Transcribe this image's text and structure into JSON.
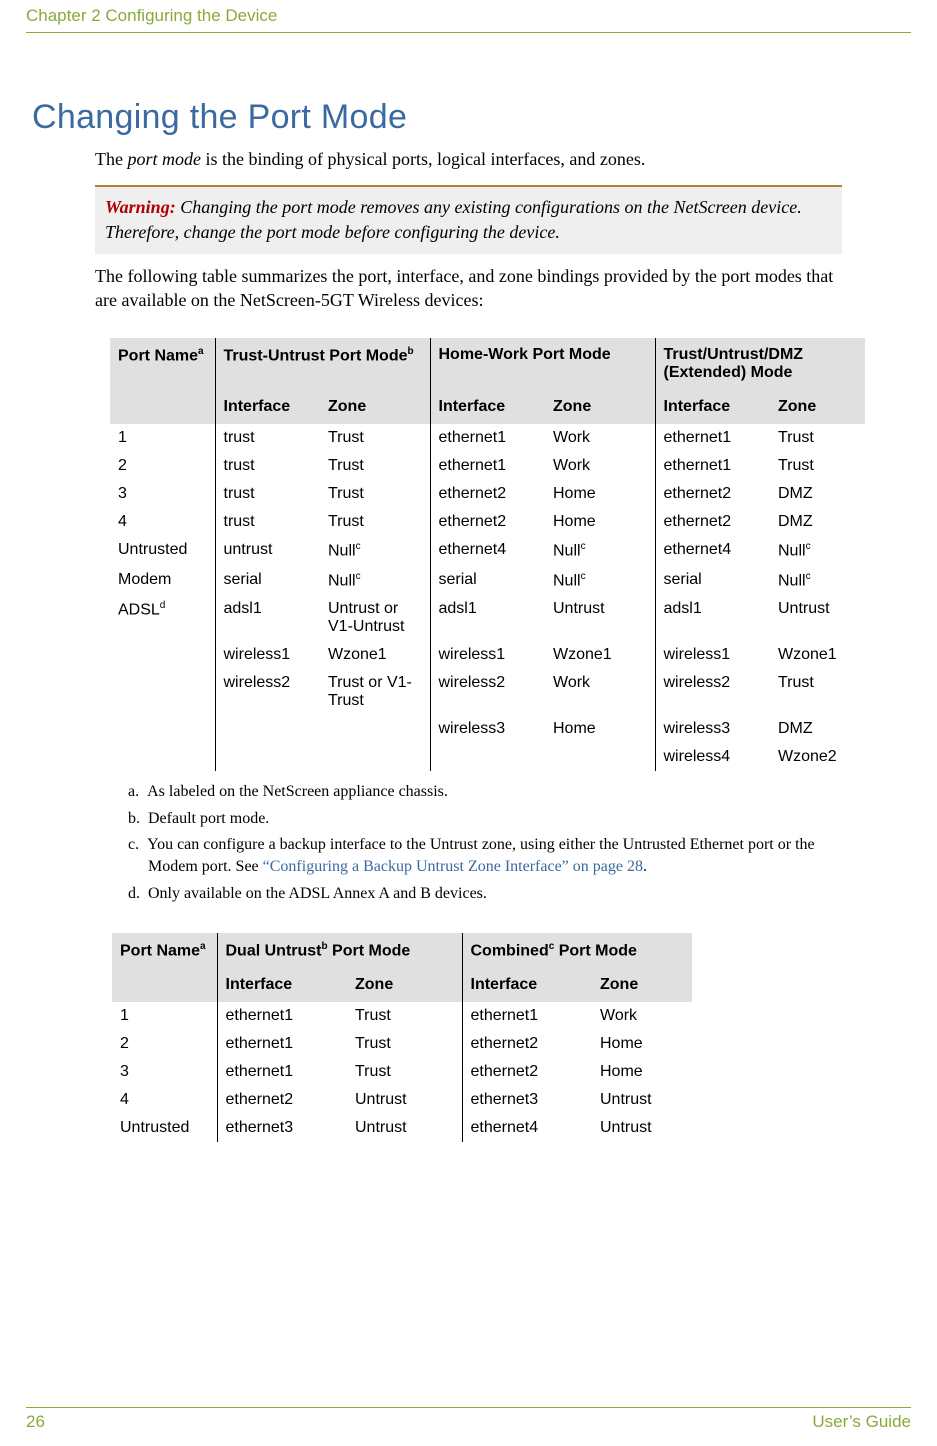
{
  "chapter": "Chapter 2 Configuring the Device",
  "sectionTitle": "Changing the Port Mode",
  "intro": "The port mode is the binding of physical ports, logical interfaces, and zones.",
  "warningLabel": "Warning:",
  "warningText": "Changing the port mode removes any existing configurations on the NetScreen device. Therefore, change the port mode before configuring the device.",
  "summaryText": "The following table summarizes the port, interface, and zone bindings provided by the port modes that are available on the NetScreen-5GT Wireless devices:",
  "table1": {
    "h_portName": "Port Name",
    "h_mode1": "Trust-Untrust Port Mode",
    "h_mode2": "Home-Work Port Mode",
    "h_mode3": "Trust/Untrust/DMZ (Extended) Mode",
    "h_interface": "Interface",
    "h_zone": "Zone",
    "sup_a": "a",
    "sup_b": "b",
    "sup_c": "c",
    "sup_d": "d",
    "rows": [
      {
        "name": "1",
        "i1": "trust",
        "z1": "Trust",
        "i2": "ethernet1",
        "z2": "Work",
        "i3": "ethernet1",
        "z3": "Trust"
      },
      {
        "name": "2",
        "i1": "trust",
        "z1": "Trust",
        "i2": "ethernet1",
        "z2": "Work",
        "i3": "ethernet1",
        "z3": "Trust"
      },
      {
        "name": "3",
        "i1": "trust",
        "z1": "Trust",
        "i2": "ethernet2",
        "z2": "Home",
        "i3": "ethernet2",
        "z3": "DMZ"
      },
      {
        "name": "4",
        "i1": "trust",
        "z1": "Trust",
        "i2": "ethernet2",
        "z2": "Home",
        "i3": "ethernet2",
        "z3": "DMZ"
      },
      {
        "name": "Untrusted",
        "i1": "untrust",
        "z1": "Null",
        "z1s": "c",
        "i2": "ethernet4",
        "z2": "Null",
        "z2s": "c",
        "i3": "ethernet4",
        "z3": "Null",
        "z3s": "c"
      },
      {
        "name": "Modem",
        "i1": "serial",
        "z1": "Null",
        "z1s": "c",
        "i2": "serial",
        "z2": "Null",
        "z2s": "c",
        "i3": "serial",
        "z3": "Null",
        "z3s": "c"
      },
      {
        "name": "ADSL",
        "ns": "d",
        "i1": "adsl1",
        "z1": "Untrust or V1-Untrust",
        "i2": "adsl1",
        "z2": "Untrust",
        "i3": "adsl1",
        "z3": "Untrust"
      },
      {
        "name": "",
        "i1": "wireless1",
        "z1": "Wzone1",
        "i2": "wireless1",
        "z2": "Wzone1",
        "i3": "wireless1",
        "z3": "Wzone1"
      },
      {
        "name": "",
        "i1": "wireless2",
        "z1": "Trust or V1-Trust",
        "i2": "wireless2",
        "z2": "Work",
        "i3": "wireless2",
        "z3": "Trust"
      },
      {
        "name": "",
        "i1": "",
        "z1": "",
        "i2": "wireless3",
        "z2": "Home",
        "i3": "wireless3",
        "z3": "DMZ"
      },
      {
        "name": "",
        "i1": "",
        "z1": "",
        "i2": "",
        "z2": "",
        "i3": "wireless4",
        "z3": "Wzone2"
      }
    ]
  },
  "footnotes": {
    "a": "As labeled on the NetScreen appliance chassis.",
    "b": "Default port mode.",
    "c_pre": "You can configure a backup interface to the Untrust zone, using either the Untrusted Ethernet port or the Modem port. See ",
    "c_link": "“Configuring a Backup Untrust Zone Interface” on page 28",
    "c_post": ".",
    "d": "Only available on the ADSL Annex A and B devices.",
    "la": "a.",
    "lb": "b.",
    "lc": "c.",
    "ld": "d."
  },
  "table2": {
    "h_portName": "Port Name",
    "h_mode1": "Dual Untrust",
    "h_mode1_suffix": " Port Mode",
    "h_mode2": "Combined",
    "h_mode2_suffix": " Port Mode",
    "h_interface": "Interface",
    "h_zone": "Zone",
    "sup_a": "a",
    "sup_b": "b",
    "sup_c": "c",
    "rows": [
      {
        "name": "1",
        "i1": "ethernet1",
        "z1": "Trust",
        "i2": "ethernet1",
        "z2": "Work"
      },
      {
        "name": "2",
        "i1": "ethernet1",
        "z1": "Trust",
        "i2": "ethernet2",
        "z2": "Home"
      },
      {
        "name": "3",
        "i1": "ethernet1",
        "z1": "Trust",
        "i2": "ethernet2",
        "z2": "Home"
      },
      {
        "name": "4",
        "i1": "ethernet2",
        "z1": "Untrust",
        "i2": "ethernet3",
        "z2": "Untrust"
      },
      {
        "name": "Untrusted",
        "i1": "ethernet3",
        "z1": "Untrust",
        "i2": "ethernet4",
        "z2": "Untrust"
      }
    ]
  },
  "footer": {
    "pageNum": "26",
    "guide": "User’s Guide"
  }
}
